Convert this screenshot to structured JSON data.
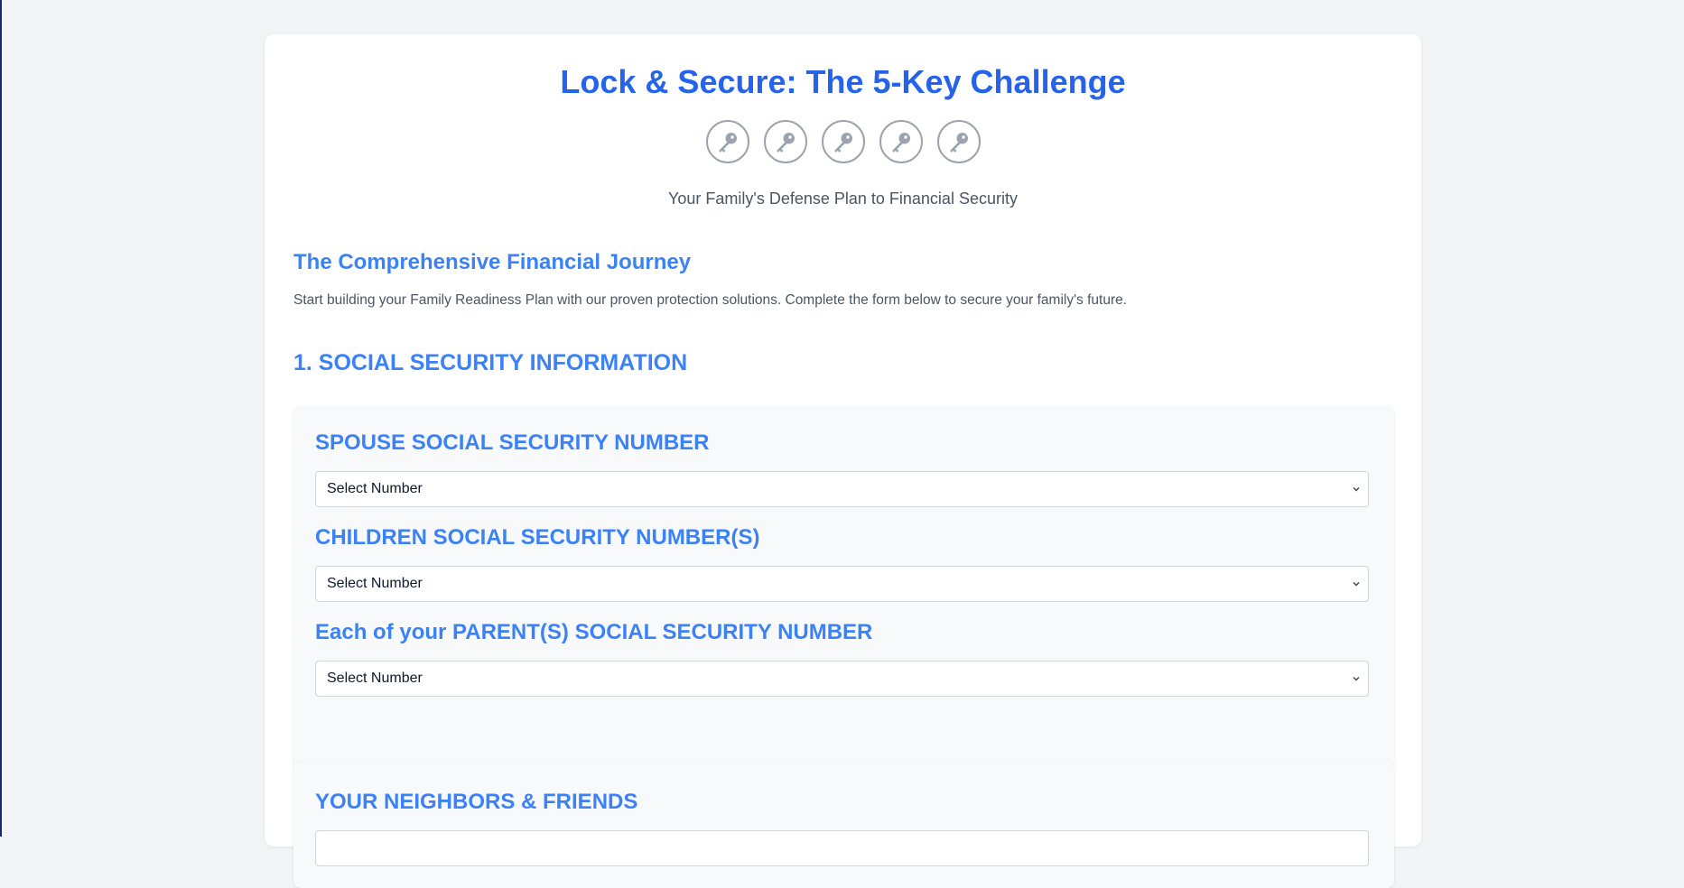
{
  "header": {
    "title": "Lock & Secure: The 5-Key Challenge",
    "key_icons": [
      "key-icon",
      "key-icon",
      "key-icon",
      "key-icon",
      "key-icon"
    ],
    "tagline": "Your Family's Defense Plan to Financial Security"
  },
  "intro": {
    "title": "The Comprehensive Financial Journey",
    "description": "Start building your Family Readiness Plan with our proven protection solutions. Complete the form below to secure your family's future."
  },
  "section1": {
    "title": "1. SOCIAL SECURITY INFORMATION",
    "fields": [
      {
        "label": "SPOUSE SOCIAL SECURITY NUMBER",
        "selected": "Select Number"
      },
      {
        "label": "CHILDREN SOCIAL SECURITY NUMBER(S)",
        "selected": "Select Number"
      },
      {
        "label": "Each of your PARENT(S) SOCIAL SECURITY NUMBER",
        "selected": "Select Number"
      }
    ]
  },
  "section2": {
    "label": "YOUR NEIGHBORS & FRIENDS"
  },
  "colors": {
    "accent": "#2563eb",
    "heading": "#3b82f6",
    "background": "#f3f4f6",
    "panel": "#f8f9fb",
    "icon": "#9ca3af"
  }
}
